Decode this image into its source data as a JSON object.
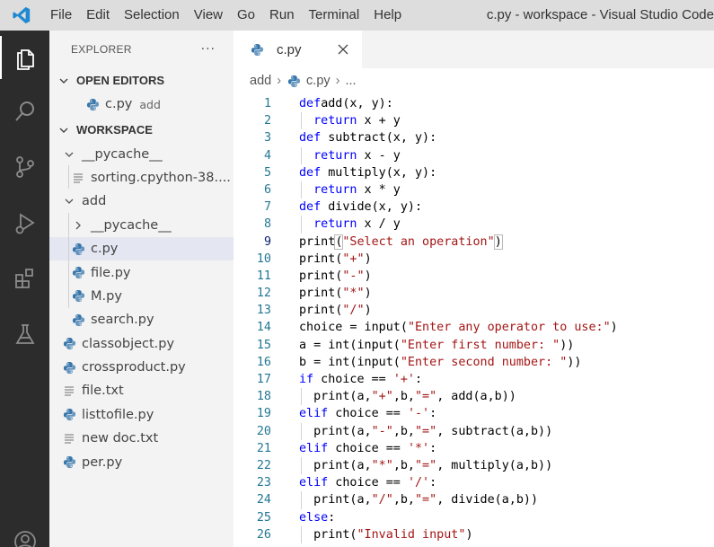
{
  "titlebar": {
    "menu": [
      "File",
      "Edit",
      "Selection",
      "View",
      "Go",
      "Run",
      "Terminal",
      "Help"
    ],
    "window_title": "c.py - workspace - Visual Studio Code"
  },
  "activity_icons": [
    "explorer-icon",
    "search-icon",
    "source-control-icon",
    "run-debug-icon",
    "extensions-icon",
    "testing-icon",
    "account-icon"
  ],
  "sidebar": {
    "title": "EXPLORER",
    "more": "···",
    "open_editors": {
      "header": "OPEN EDITORS",
      "items": [
        {
          "label": "c.py",
          "desc": "add",
          "icon": "python-icon"
        }
      ]
    },
    "workspace": {
      "header": "WORKSPACE",
      "items": [
        {
          "label": "__pycache__",
          "type": "folder-open",
          "depth": 1,
          "icon": "chevron-down-icon"
        },
        {
          "label": "sorting.cpython-38....",
          "type": "file",
          "depth": 2,
          "icon": "file-lines-icon"
        },
        {
          "label": "add",
          "type": "folder-open",
          "depth": 1,
          "icon": "chevron-down-icon"
        },
        {
          "label": "__pycache__",
          "type": "folder-closed",
          "depth": 2,
          "icon": "chevron-right-icon"
        },
        {
          "label": "c.py",
          "type": "file",
          "depth": 2,
          "icon": "python-icon",
          "selected": true
        },
        {
          "label": "file.py",
          "type": "file",
          "depth": 2,
          "icon": "python-icon"
        },
        {
          "label": "M.py",
          "type": "file",
          "depth": 2,
          "icon": "python-icon"
        },
        {
          "label": "search.py",
          "type": "file",
          "depth": 2,
          "icon": "python-icon"
        },
        {
          "label": "classobject.py",
          "type": "file",
          "depth": 1,
          "icon": "python-icon"
        },
        {
          "label": "crossproduct.py",
          "type": "file",
          "depth": 1,
          "icon": "python-icon"
        },
        {
          "label": "file.txt",
          "type": "file",
          "depth": 1,
          "icon": "file-lines-icon"
        },
        {
          "label": "listtofile.py",
          "type": "file",
          "depth": 1,
          "icon": "python-icon"
        },
        {
          "label": "new doc.txt",
          "type": "file",
          "depth": 1,
          "icon": "file-lines-icon"
        },
        {
          "label": "per.py",
          "type": "file",
          "depth": 1,
          "icon": "python-icon"
        }
      ]
    }
  },
  "editor": {
    "tab_label": "c.py",
    "breadcrumb": {
      "folder": "add",
      "file": "c.py",
      "more": "..."
    },
    "current_line": 9,
    "lines": [
      {
        "n": "1",
        "indent": false,
        "tokens": [
          [
            "kw",
            "def"
          ],
          [
            "",
            "add(x, y):"
          ]
        ]
      },
      {
        "n": "2",
        "indent": true,
        "tokens": [
          [
            "kw",
            "return"
          ],
          [
            "",
            " x + y"
          ]
        ]
      },
      {
        "n": "3",
        "indent": false,
        "tokens": [
          [
            "kw",
            "def"
          ],
          [
            "",
            " subtract(x, y):"
          ]
        ]
      },
      {
        "n": "4",
        "indent": true,
        "tokens": [
          [
            "kw",
            "return"
          ],
          [
            "",
            " x - y"
          ]
        ]
      },
      {
        "n": "5",
        "indent": false,
        "tokens": [
          [
            "kw",
            "def"
          ],
          [
            "",
            " multiply(x, y):"
          ]
        ]
      },
      {
        "n": "6",
        "indent": true,
        "tokens": [
          [
            "kw",
            "return"
          ],
          [
            "",
            " x * y"
          ]
        ]
      },
      {
        "n": "7",
        "indent": false,
        "tokens": [
          [
            "kw",
            "def"
          ],
          [
            "",
            " divide(x, y):"
          ]
        ]
      },
      {
        "n": "8",
        "indent": true,
        "tokens": [
          [
            "kw",
            "return"
          ],
          [
            "",
            " x / y"
          ]
        ]
      },
      {
        "n": "9",
        "indent": false,
        "tokens": [
          [
            "",
            "print"
          ],
          [
            "br",
            "("
          ],
          [
            "str",
            "\"Select an operation\""
          ],
          [
            "br",
            ")"
          ]
        ]
      },
      {
        "n": "10",
        "indent": false,
        "tokens": [
          [
            "",
            "print("
          ],
          [
            "str",
            "\"+\""
          ],
          [
            "",
            ")"
          ]
        ]
      },
      {
        "n": "11",
        "indent": false,
        "tokens": [
          [
            "",
            "print("
          ],
          [
            "str",
            "\"-\""
          ],
          [
            "",
            ")"
          ]
        ]
      },
      {
        "n": "12",
        "indent": false,
        "tokens": [
          [
            "",
            "print("
          ],
          [
            "str",
            "\"*\""
          ],
          [
            "",
            ")"
          ]
        ]
      },
      {
        "n": "13",
        "indent": false,
        "tokens": [
          [
            "",
            "print("
          ],
          [
            "str",
            "\"/\""
          ],
          [
            "",
            ")"
          ]
        ]
      },
      {
        "n": "14",
        "indent": false,
        "tokens": [
          [
            "",
            "choice = input("
          ],
          [
            "str",
            "\"Enter any operator to use:\""
          ],
          [
            "",
            ")"
          ]
        ]
      },
      {
        "n": "15",
        "indent": false,
        "tokens": [
          [
            "",
            "a = int(input("
          ],
          [
            "str",
            "\"Enter first number: \""
          ],
          [
            "",
            "))"
          ]
        ]
      },
      {
        "n": "16",
        "indent": false,
        "tokens": [
          [
            "",
            "b = int(input("
          ],
          [
            "str",
            "\"Enter second number: \""
          ],
          [
            "",
            "))"
          ]
        ]
      },
      {
        "n": "17",
        "indent": false,
        "tokens": [
          [
            "kw",
            "if"
          ],
          [
            "",
            " choice == "
          ],
          [
            "str",
            "'+'"
          ],
          [
            "",
            ":"
          ]
        ]
      },
      {
        "n": "18",
        "indent": true,
        "tokens": [
          [
            "",
            "print(a,"
          ],
          [
            "str",
            "\"+\""
          ],
          [
            "",
            ",b,"
          ],
          [
            "str",
            "\"=\""
          ],
          [
            "",
            ", add(a,b))"
          ]
        ]
      },
      {
        "n": "19",
        "indent": false,
        "tokens": [
          [
            "kw",
            "elif"
          ],
          [
            "",
            " choice == "
          ],
          [
            "str",
            "'-'"
          ],
          [
            "",
            ":"
          ]
        ]
      },
      {
        "n": "20",
        "indent": true,
        "tokens": [
          [
            "",
            "print(a,"
          ],
          [
            "str",
            "\"-\""
          ],
          [
            "",
            ",b,"
          ],
          [
            "str",
            "\"=\""
          ],
          [
            "",
            ", subtract(a,b))"
          ]
        ]
      },
      {
        "n": "21",
        "indent": false,
        "tokens": [
          [
            "kw",
            "elif"
          ],
          [
            "",
            " choice == "
          ],
          [
            "str",
            "'*'"
          ],
          [
            "",
            ":"
          ]
        ]
      },
      {
        "n": "22",
        "indent": true,
        "tokens": [
          [
            "",
            "print(a,"
          ],
          [
            "str",
            "\"*\""
          ],
          [
            "",
            ",b,"
          ],
          [
            "str",
            "\"=\""
          ],
          [
            "",
            ", multiply(a,b))"
          ]
        ]
      },
      {
        "n": "23",
        "indent": false,
        "tokens": [
          [
            "kw",
            "elif"
          ],
          [
            "",
            " choice == "
          ],
          [
            "str",
            "'/'"
          ],
          [
            "",
            ":"
          ]
        ]
      },
      {
        "n": "24",
        "indent": true,
        "tokens": [
          [
            "",
            "print(a,"
          ],
          [
            "str",
            "\"/\""
          ],
          [
            "",
            ",b,"
          ],
          [
            "str",
            "\"=\""
          ],
          [
            "",
            ", divide(a,b))"
          ]
        ]
      },
      {
        "n": "25",
        "indent": false,
        "tokens": [
          [
            "kw",
            "else"
          ],
          [
            "",
            ":"
          ]
        ]
      },
      {
        "n": "26",
        "indent": true,
        "tokens": [
          [
            "",
            "print("
          ],
          [
            "str",
            "\"Invalid input\""
          ],
          [
            "",
            ")"
          ]
        ]
      }
    ]
  }
}
